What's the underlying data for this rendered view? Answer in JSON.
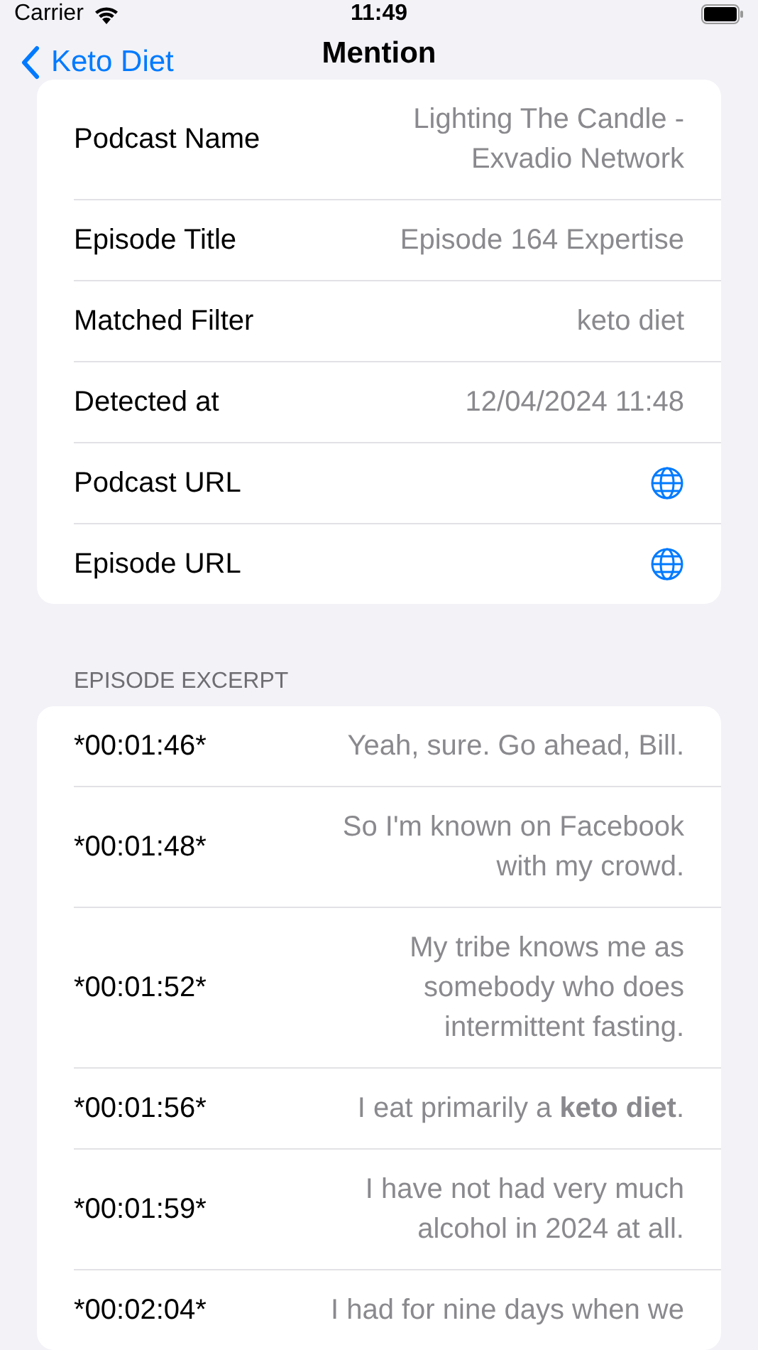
{
  "status_bar": {
    "carrier": "Carrier",
    "time": "11:49"
  },
  "nav": {
    "back": "Keto Diet",
    "title": "Mention"
  },
  "details": [
    {
      "kind": "text",
      "label": "Podcast Name",
      "value": "Lighting The Candle - Exvadio Network"
    },
    {
      "kind": "text",
      "label": "Episode Title",
      "value": "Episode 164 Expertise"
    },
    {
      "kind": "text",
      "label": "Matched Filter",
      "value": "keto diet"
    },
    {
      "kind": "text",
      "label": "Detected at",
      "value": "12/04/2024 11:48"
    },
    {
      "kind": "link",
      "label": "Podcast URL"
    },
    {
      "kind": "link",
      "label": "Episode URL"
    }
  ],
  "excerpt": {
    "header": "EPISODE EXCERPT",
    "rows": [
      {
        "time": "*00:01:46*",
        "text": "Yeah, sure. Go ahead, Bill."
      },
      {
        "time": "*00:01:48*",
        "text": "So I'm known on Facebook with my crowd."
      },
      {
        "time": "*00:01:52*",
        "text": "My tribe knows me as somebody who does intermittent fasting."
      },
      {
        "time": "*00:01:56*",
        "text": "I eat primarily a **keto diet**."
      },
      {
        "time": "*00:01:59*",
        "text": "I have not had very much alcohol in 2024 at all."
      },
      {
        "time": "*00:02:04*",
        "text": "I had for nine days when we"
      }
    ]
  }
}
